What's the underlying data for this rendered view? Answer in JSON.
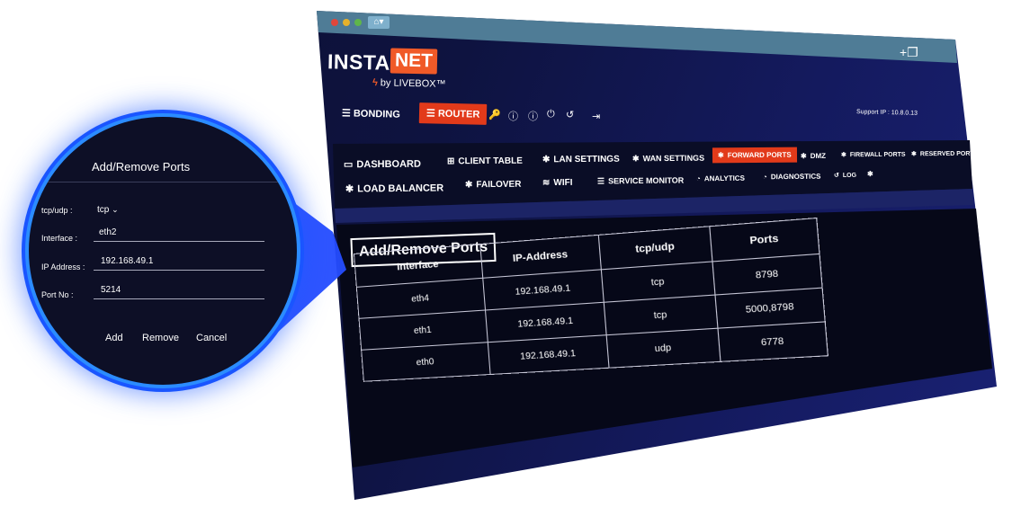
{
  "app": {
    "logo_left": "INSTA",
    "logo_right": "NET",
    "logo_sub": "by LIVEBOX™",
    "support_ip": "Support IP : 10.8.0.13"
  },
  "top_nav": {
    "bonding": "BONDING",
    "router": "ROUTER"
  },
  "sub_nav": {
    "dashboard": "DASHBOARD",
    "client_table": "CLIENT TABLE",
    "lan_settings": "LAN SETTINGS",
    "wan_settings": "WAN SETTINGS",
    "forward_ports": "FORWARD PORTS",
    "dmz": "DMZ",
    "firewall_ports": "FIREWALL PORTS",
    "reserved_ports": "RESERVED PORTS",
    "load_balancer": "LOAD BALANCER",
    "failover": "FAILOVER",
    "wifi": "WIFI",
    "service_monitor": "SERVICE MONITOR",
    "analytics": "ANALYTICS",
    "diagnostics": "DIAGNOSTICS",
    "log": "LOG"
  },
  "ports_table": {
    "title": "Add/Remove Ports",
    "headers": [
      "Interface",
      "IP-Address",
      "tcp/udp",
      "Ports"
    ],
    "rows": [
      [
        "eth4",
        "192.168.49.1",
        "tcp",
        "8798"
      ],
      [
        "eth1",
        "192.168.49.1",
        "tcp",
        "5000,8798"
      ],
      [
        "eth0",
        "192.168.49.1",
        "udp",
        "6778"
      ]
    ]
  },
  "dialog": {
    "title": "Add/Remove Ports",
    "tcp_udp_label": "tcp/udp :",
    "tcp_udp_value": "tcp",
    "interface_label": "Interface :",
    "interface_value": "eth2",
    "ip_label": "IP Address :",
    "ip_value": "192.168.49.1",
    "port_label": "Port No :",
    "port_value": "5214",
    "add": "Add",
    "remove": "Remove",
    "cancel": "Cancel"
  },
  "colors": {
    "accent": "#e23a1a",
    "logo_orange": "#f05a28",
    "magnifier_ring": "#2b8cff"
  },
  "icons": [
    "home-icon",
    "plus-icon",
    "copy-icon",
    "menu-icon",
    "wrench-icon",
    "info-icon",
    "power-icon",
    "undo-icon",
    "signout-icon",
    "monitor-icon",
    "grid-icon",
    "gear-icon",
    "wifi-icon",
    "analytics-icon",
    "chevron-down-icon"
  ]
}
